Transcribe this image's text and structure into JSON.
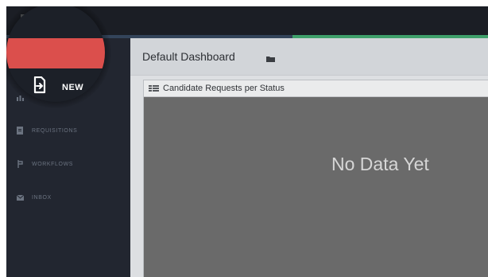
{
  "sidebar": {
    "new_button_label": "NEW",
    "items": [
      {
        "label": "",
        "icon": "bar-chart-icon"
      },
      {
        "label": "REQUISITIONS",
        "icon": "document-icon"
      },
      {
        "label": "WORKFLOWS",
        "icon": "workflow-icon"
      },
      {
        "label": "INBOX",
        "icon": "envelope-icon"
      }
    ]
  },
  "header": {
    "title": "Default Dashboard",
    "folder_icon": "folder-icon"
  },
  "widget": {
    "title": "Candidate Requests per Status",
    "icon": "list-icon",
    "empty_message": "No Data Yet"
  },
  "colors": {
    "accent_red": "#db4f4c",
    "accent_green": "#3fa06b",
    "sidebar_bg": "#222630",
    "topbar_bg": "#1b1e25",
    "widget_bg": "#6a6a6a"
  }
}
